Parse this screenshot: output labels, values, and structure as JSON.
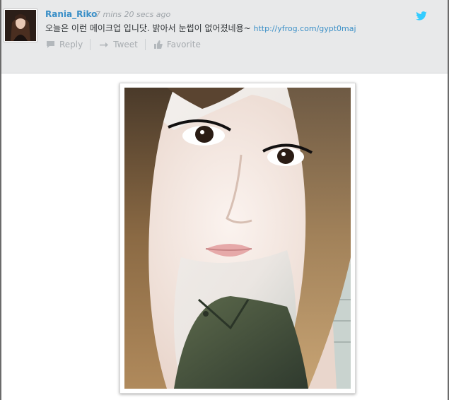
{
  "tweet": {
    "username": "Rania_Riko",
    "timestamp": "7 mins 20 secs ago",
    "text": "오늘은 이런 메이크업 입니닷. 밝아서 눈썹이 없어졌네용~ ",
    "link": "http://yfrog.com/gypt0maj"
  },
  "actions": [
    {
      "label": "Reply",
      "icon": "reply-icon"
    },
    {
      "label": "Tweet",
      "icon": "retweet-icon"
    },
    {
      "label": "Favorite",
      "icon": "thumbs-up-icon"
    }
  ],
  "icons": {
    "brand": "twitter-bird-icon"
  },
  "colors": {
    "link": "#3a8fc7",
    "header_background": "#e8e9ea",
    "action_text": "#a7acb0",
    "twitter_blue": "#33ccff"
  }
}
